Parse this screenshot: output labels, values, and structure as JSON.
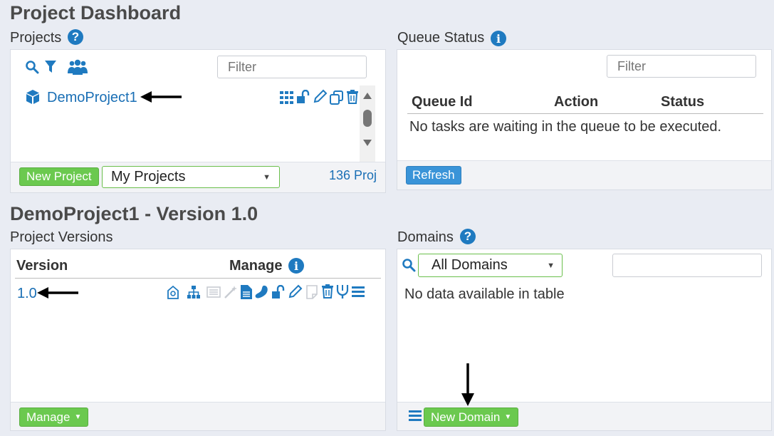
{
  "page": {
    "title": "Project Dashboard"
  },
  "projects": {
    "heading": "Projects",
    "filter_placeholder": "Filter",
    "items": [
      {
        "name": "DemoProject1"
      }
    ],
    "new_button": "New Project",
    "scope_select": "My Projects",
    "count": "136 Proj"
  },
  "queue": {
    "heading": "Queue Status",
    "filter_placeholder": "Filter",
    "columns": [
      "Queue Id",
      "Action",
      "Status"
    ],
    "empty_text": "No tasks are waiting in the queue to be executed.",
    "refresh_button": "Refresh"
  },
  "project_detail": {
    "title": "DemoProject1 - Version 1.0"
  },
  "versions": {
    "heading": "Project Versions",
    "col_version": "Version",
    "col_manage": "Manage",
    "rows": [
      {
        "version": "1.0"
      }
    ],
    "manage_button": "Manage"
  },
  "domains": {
    "heading": "Domains",
    "select": "All Domains",
    "search_value": "",
    "empty_text": "No data available in table",
    "new_button": "New Domain"
  },
  "colors": {
    "accent_blue": "#1f7ac0",
    "green": "#6bc94f",
    "refresh_blue": "#3a94d8",
    "background": "#e9ecf3"
  }
}
